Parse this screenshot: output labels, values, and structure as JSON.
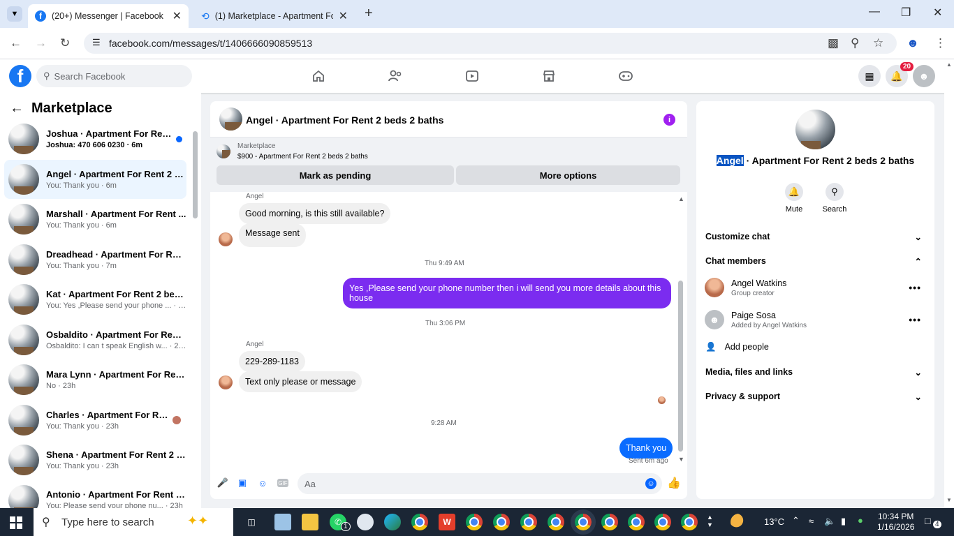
{
  "browser": {
    "tabs": [
      {
        "title": "(20+) Messenger | Facebook"
      },
      {
        "title": "(1) Marketplace - Apartment Fo"
      }
    ],
    "url": "facebook.com/messages/t/1406666090859513"
  },
  "fb": {
    "search_placeholder": "Search Facebook",
    "notification_count": "20"
  },
  "sidebar": {
    "title": "Marketplace",
    "conversations": [
      {
        "name": "Joshua · Apartment For Rent ...",
        "preview": "Joshua: 470 606 0230 · 6m",
        "unread": true
      },
      {
        "name": "Angel · Apartment For Rent 2 b...",
        "preview": "You: Thank you · 6m",
        "active": true
      },
      {
        "name": "Marshall · Apartment For Rent ...",
        "preview": "You: Thank you · 6m"
      },
      {
        "name": "Dreadhead · Apartment For Ren...",
        "preview": "You: Thank you · 7m"
      },
      {
        "name": "Kat · Apartment For Rent 2 bed...",
        "preview": "You: Yes ,Please send your phone ... · 7m"
      },
      {
        "name": "Osbaldito · Apartment For Rent ...",
        "preview": "Osbaldito: I can t speak English w... · 23h"
      },
      {
        "name": "Mara Lynn · Apartment For Ren...",
        "preview": "No · 23h"
      },
      {
        "name": "Charles · Apartment For Rent ...",
        "preview": "You: Thank you · 23h"
      },
      {
        "name": "Shena · Apartment For Rent 2 b...",
        "preview": "You: Thank you · 23h"
      },
      {
        "name": "Antonio · Apartment For Rent 2...",
        "preview": "You: Please send your phone nu... · 23h"
      }
    ]
  },
  "chat": {
    "title": "Angel · Apartment For Rent 2 beds 2 baths",
    "marketplace_label": "Marketplace",
    "listing": "$900 - Apartment For Rent 2 beds 2 baths",
    "mark_pending": "Mark as pending",
    "more_options": "More options",
    "sender_1": "Angel",
    "msg_1": "Good morning, is this still available?",
    "msg_2": "Message sent",
    "time_1": "Thu 9:49 AM",
    "msg_3": "Yes ,Please send your phone number then i will send you more details about this house",
    "time_2": "Thu 3:06 PM",
    "sender_2": "Angel",
    "msg_4": "229-289-1183",
    "msg_5": "Text only please or message",
    "time_3": "9:28 AM",
    "msg_6": "Thank you",
    "sent_status": "Sent 6m ago",
    "composer_placeholder": "Aa"
  },
  "info": {
    "title_highlight": "Angel",
    "title_rest": " · Apartment For Rent 2 beds 2 baths",
    "mute": "Mute",
    "search": "Search",
    "customize": "Customize chat",
    "members_header": "Chat members",
    "members": [
      {
        "name": "Angel Watkins",
        "role": "Group creator"
      },
      {
        "name": "Paige Sosa",
        "role": "Added by Angel Watkins"
      }
    ],
    "add_people": "Add people",
    "media": "Media, files and links",
    "privacy": "Privacy & support"
  },
  "taskbar": {
    "search_placeholder": "Type here to search",
    "temperature": "13°C",
    "time": "10:34 PM",
    "date": "1/16/2026",
    "notif": "4",
    "whatsapp_badge": "1"
  }
}
